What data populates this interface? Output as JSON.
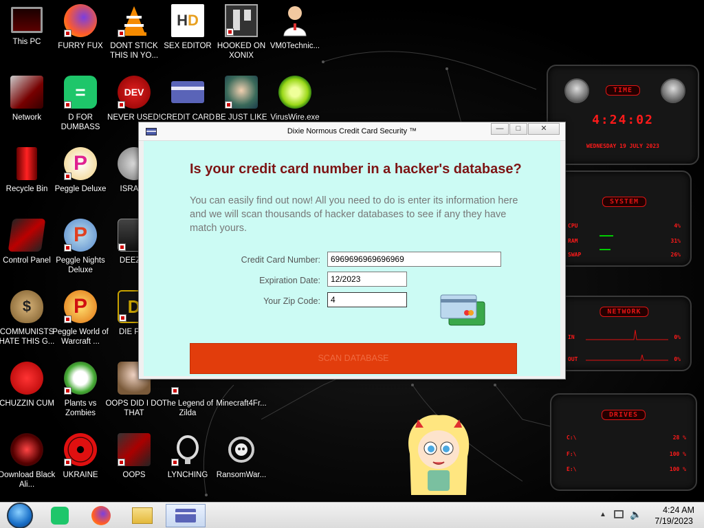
{
  "desktop": {
    "icons": [
      {
        "label": "This PC",
        "icon": "computer-icon"
      },
      {
        "label": "FURRY FUX",
        "icon": "firefox-icon"
      },
      {
        "label": "DONT STICK THIS IN YO...",
        "icon": "vlc-icon"
      },
      {
        "label": "SEX EDITOR",
        "icon": "hxd-icon"
      },
      {
        "label": "HOOKED ON XONIX",
        "icon": "xonix-icon"
      },
      {
        "label": "VM0Technic...",
        "icon": "technician-icon"
      },
      {
        "label": "Network",
        "icon": "network-icon"
      },
      {
        "label": "D FOR DUMBASS",
        "icon": "d-app-icon"
      },
      {
        "label": "NEVER USED!",
        "icon": "devcpp-icon"
      },
      {
        "label": "CREDIT CARD",
        "icon": "credit-card-app-icon"
      },
      {
        "label": "BE JUST LIKE",
        "icon": "elf-icon"
      },
      {
        "label": "VirusWire.exe",
        "icon": "lime-icon"
      },
      {
        "label": "Recycle Bin",
        "icon": "recycle-bin-icon"
      },
      {
        "label": "Peggle Deluxe",
        "icon": "peggle-icon"
      },
      {
        "label": "ISRAEL",
        "icon": "israel-icon"
      },
      {
        "label": "Control Panel",
        "icon": "control-panel-icon"
      },
      {
        "label": "Peggle Nights Deluxe",
        "icon": "peggle-nights-icon"
      },
      {
        "label": "DEEZ N",
        "icon": "deez-icon"
      },
      {
        "label": "COMMUNISTS HATE THIS G...",
        "icon": "money-bag-icon"
      },
      {
        "label": "Peggle World of Warcraft ...",
        "icon": "peggle-wow-icon"
      },
      {
        "label": "DIE PLE",
        "icon": "die-icon"
      },
      {
        "label": "CHUZZIN CUM",
        "icon": "chuzzle-icon"
      },
      {
        "label": "Plants vs Zombies",
        "icon": "pvz-icon"
      },
      {
        "label": "OOPS DID I DO THAT",
        "icon": "portrait-icon"
      },
      {
        "label": "The Legend of Zilda",
        "icon": "zelda-icon"
      },
      {
        "label": "Minecraft4Fr...",
        "icon": "minecraft-icon"
      },
      {
        "label": "Download Black Ali...",
        "icon": "alienware-icon"
      },
      {
        "label": "UKRAINE",
        "icon": "radiation-icon"
      },
      {
        "label": "OOPS",
        "icon": "oops-icon"
      },
      {
        "label": "LYNCHING",
        "icon": "rope-icon"
      },
      {
        "label": "RansomWar...",
        "icon": "skull-icon"
      }
    ]
  },
  "gadgets": {
    "time": {
      "title": "TIME",
      "clock": "4:24:02",
      "date": "WEDNESDAY 19 JULY 2023"
    },
    "system": {
      "title": "SYSTEM",
      "rows": [
        {
          "label": "CPU",
          "value": "4%"
        },
        {
          "label": "RAM",
          "value": "31%"
        },
        {
          "label": "SWAP",
          "value": "26%"
        }
      ]
    },
    "network": {
      "title": "NETWORK",
      "rows": [
        {
          "label": "IN",
          "value": "0%"
        },
        {
          "label": "OUT",
          "value": "0%"
        }
      ]
    },
    "drives": {
      "title": "DRIVES",
      "rows": [
        {
          "label": "C:\\",
          "value": "28 %"
        },
        {
          "label": "F:\\",
          "value": "100 %"
        },
        {
          "label": "E:\\",
          "value": "100 %"
        }
      ]
    }
  },
  "window": {
    "title": "Dixie Normous Credit Card Security ™",
    "minimize_glyph": "—",
    "maximize_glyph": "□",
    "close_glyph": "✕",
    "heading": "Is your credit card number in a hacker's database?",
    "intro": "You can easily find out now! All you need to do is enter its information here and we will scan thousands of hacker databases to see if any they have match yours.",
    "fields": {
      "card_label": "Credit Card Number:",
      "card_value": "6969696969696969",
      "exp_label": "Expiration Date:",
      "exp_value": "12/2023",
      "zip_label": "Your Zip Code:",
      "zip_value": "4"
    },
    "scan_button": "SCAN DATABASE"
  },
  "taskbar": {
    "items": [
      "start-orb-icon",
      "d-app-icon",
      "firefox-icon",
      "file-explorer-icon",
      "credit-card-app-icon"
    ],
    "tray_icons": [
      "show-hidden-icons-arrow",
      "network-tray-icon",
      "volume-icon"
    ],
    "time": "4:24 AM",
    "date": "7/19/2023"
  }
}
